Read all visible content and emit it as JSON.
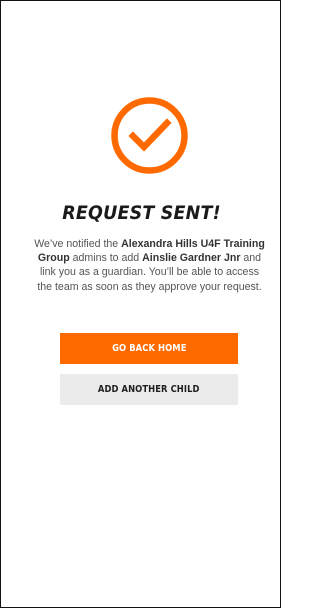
{
  "header": {
    "title": "REQUEST SENT!"
  },
  "icon": {
    "name": "checkmark-circle-icon",
    "color": "#ff6a00"
  },
  "message": {
    "part1": "We’ve notified the ",
    "group_name": "Alexandra Hills U4F Training Group",
    "part2": " admins to add ",
    "child_name": "Ainslie Gardner Jnr",
    "part3": " and link you as a guardian. You’ll be able to access the team as soon as they approve your request."
  },
  "actions": {
    "primary_label": "GO BACK HOME",
    "secondary_label": "ADD ANOTHER CHILD"
  },
  "colors": {
    "accent": "#ff6a00",
    "secondary_bg": "#ebebeb",
    "text_dark": "#1a1a1a",
    "text_body": "#555555"
  }
}
